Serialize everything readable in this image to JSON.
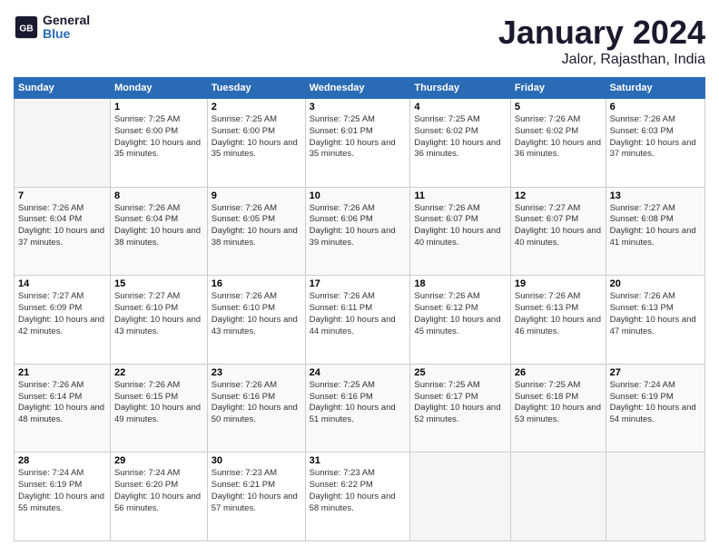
{
  "logo": {
    "line1": "General",
    "line2": "Blue"
  },
  "title": "January 2024",
  "subtitle": "Jalor, Rajasthan, India",
  "weekdays": [
    "Sunday",
    "Monday",
    "Tuesday",
    "Wednesday",
    "Thursday",
    "Friday",
    "Saturday"
  ],
  "weeks": [
    [
      {
        "day": "",
        "sunrise": "",
        "sunset": "",
        "daylight": ""
      },
      {
        "day": "1",
        "sunrise": "Sunrise: 7:25 AM",
        "sunset": "Sunset: 6:00 PM",
        "daylight": "Daylight: 10 hours and 35 minutes."
      },
      {
        "day": "2",
        "sunrise": "Sunrise: 7:25 AM",
        "sunset": "Sunset: 6:00 PM",
        "daylight": "Daylight: 10 hours and 35 minutes."
      },
      {
        "day": "3",
        "sunrise": "Sunrise: 7:25 AM",
        "sunset": "Sunset: 6:01 PM",
        "daylight": "Daylight: 10 hours and 35 minutes."
      },
      {
        "day": "4",
        "sunrise": "Sunrise: 7:25 AM",
        "sunset": "Sunset: 6:02 PM",
        "daylight": "Daylight: 10 hours and 36 minutes."
      },
      {
        "day": "5",
        "sunrise": "Sunrise: 7:26 AM",
        "sunset": "Sunset: 6:02 PM",
        "daylight": "Daylight: 10 hours and 36 minutes."
      },
      {
        "day": "6",
        "sunrise": "Sunrise: 7:26 AM",
        "sunset": "Sunset: 6:03 PM",
        "daylight": "Daylight: 10 hours and 37 minutes."
      }
    ],
    [
      {
        "day": "7",
        "sunrise": "Sunrise: 7:26 AM",
        "sunset": "Sunset: 6:04 PM",
        "daylight": "Daylight: 10 hours and 37 minutes."
      },
      {
        "day": "8",
        "sunrise": "Sunrise: 7:26 AM",
        "sunset": "Sunset: 6:04 PM",
        "daylight": "Daylight: 10 hours and 38 minutes."
      },
      {
        "day": "9",
        "sunrise": "Sunrise: 7:26 AM",
        "sunset": "Sunset: 6:05 PM",
        "daylight": "Daylight: 10 hours and 38 minutes."
      },
      {
        "day": "10",
        "sunrise": "Sunrise: 7:26 AM",
        "sunset": "Sunset: 6:06 PM",
        "daylight": "Daylight: 10 hours and 39 minutes."
      },
      {
        "day": "11",
        "sunrise": "Sunrise: 7:26 AM",
        "sunset": "Sunset: 6:07 PM",
        "daylight": "Daylight: 10 hours and 40 minutes."
      },
      {
        "day": "12",
        "sunrise": "Sunrise: 7:27 AM",
        "sunset": "Sunset: 6:07 PM",
        "daylight": "Daylight: 10 hours and 40 minutes."
      },
      {
        "day": "13",
        "sunrise": "Sunrise: 7:27 AM",
        "sunset": "Sunset: 6:08 PM",
        "daylight": "Daylight: 10 hours and 41 minutes."
      }
    ],
    [
      {
        "day": "14",
        "sunrise": "Sunrise: 7:27 AM",
        "sunset": "Sunset: 6:09 PM",
        "daylight": "Daylight: 10 hours and 42 minutes."
      },
      {
        "day": "15",
        "sunrise": "Sunrise: 7:27 AM",
        "sunset": "Sunset: 6:10 PM",
        "daylight": "Daylight: 10 hours and 43 minutes."
      },
      {
        "day": "16",
        "sunrise": "Sunrise: 7:26 AM",
        "sunset": "Sunset: 6:10 PM",
        "daylight": "Daylight: 10 hours and 43 minutes."
      },
      {
        "day": "17",
        "sunrise": "Sunrise: 7:26 AM",
        "sunset": "Sunset: 6:11 PM",
        "daylight": "Daylight: 10 hours and 44 minutes."
      },
      {
        "day": "18",
        "sunrise": "Sunrise: 7:26 AM",
        "sunset": "Sunset: 6:12 PM",
        "daylight": "Daylight: 10 hours and 45 minutes."
      },
      {
        "day": "19",
        "sunrise": "Sunrise: 7:26 AM",
        "sunset": "Sunset: 6:13 PM",
        "daylight": "Daylight: 10 hours and 46 minutes."
      },
      {
        "day": "20",
        "sunrise": "Sunrise: 7:26 AM",
        "sunset": "Sunset: 6:13 PM",
        "daylight": "Daylight: 10 hours and 47 minutes."
      }
    ],
    [
      {
        "day": "21",
        "sunrise": "Sunrise: 7:26 AM",
        "sunset": "Sunset: 6:14 PM",
        "daylight": "Daylight: 10 hours and 48 minutes."
      },
      {
        "day": "22",
        "sunrise": "Sunrise: 7:26 AM",
        "sunset": "Sunset: 6:15 PM",
        "daylight": "Daylight: 10 hours and 49 minutes."
      },
      {
        "day": "23",
        "sunrise": "Sunrise: 7:26 AM",
        "sunset": "Sunset: 6:16 PM",
        "daylight": "Daylight: 10 hours and 50 minutes."
      },
      {
        "day": "24",
        "sunrise": "Sunrise: 7:25 AM",
        "sunset": "Sunset: 6:16 PM",
        "daylight": "Daylight: 10 hours and 51 minutes."
      },
      {
        "day": "25",
        "sunrise": "Sunrise: 7:25 AM",
        "sunset": "Sunset: 6:17 PM",
        "daylight": "Daylight: 10 hours and 52 minutes."
      },
      {
        "day": "26",
        "sunrise": "Sunrise: 7:25 AM",
        "sunset": "Sunset: 6:18 PM",
        "daylight": "Daylight: 10 hours and 53 minutes."
      },
      {
        "day": "27",
        "sunrise": "Sunrise: 7:24 AM",
        "sunset": "Sunset: 6:19 PM",
        "daylight": "Daylight: 10 hours and 54 minutes."
      }
    ],
    [
      {
        "day": "28",
        "sunrise": "Sunrise: 7:24 AM",
        "sunset": "Sunset: 6:19 PM",
        "daylight": "Daylight: 10 hours and 55 minutes."
      },
      {
        "day": "29",
        "sunrise": "Sunrise: 7:24 AM",
        "sunset": "Sunset: 6:20 PM",
        "daylight": "Daylight: 10 hours and 56 minutes."
      },
      {
        "day": "30",
        "sunrise": "Sunrise: 7:23 AM",
        "sunset": "Sunset: 6:21 PM",
        "daylight": "Daylight: 10 hours and 57 minutes."
      },
      {
        "day": "31",
        "sunrise": "Sunrise: 7:23 AM",
        "sunset": "Sunset: 6:22 PM",
        "daylight": "Daylight: 10 hours and 58 minutes."
      },
      {
        "day": "",
        "sunrise": "",
        "sunset": "",
        "daylight": ""
      },
      {
        "day": "",
        "sunrise": "",
        "sunset": "",
        "daylight": ""
      },
      {
        "day": "",
        "sunrise": "",
        "sunset": "",
        "daylight": ""
      }
    ]
  ]
}
